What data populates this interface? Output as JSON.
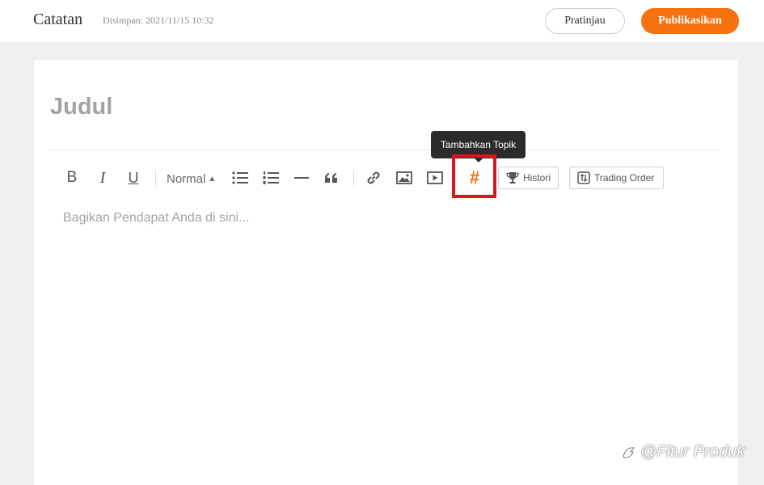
{
  "header": {
    "app_title": "Catatan",
    "save_status": "Disimpan: 2021/11/15 10:32",
    "preview_label": "Pratinjau",
    "publish_label": "Publikasikan"
  },
  "editor": {
    "title_placeholder": "Judul",
    "body_placeholder": "Bagikan Pendapat Anda di sini...",
    "toolbar": {
      "bold": "B",
      "italic": "I",
      "underline": "U",
      "format_select": "Normal",
      "topic_icon": "#",
      "topic_tooltip": "Tambahkan Topik",
      "history_label": "Histori",
      "trading_order_label": "Trading Order"
    }
  },
  "watermark": {
    "text": "@Fitur Produk"
  },
  "colors": {
    "accent": "#f7710f",
    "highlight": "#e0121c",
    "tooltip_bg": "#2b2b2b",
    "page_bg": "#efefef"
  },
  "icons": [
    "bullet-list-icon",
    "numbered-list-icon",
    "horizontal-rule-icon",
    "quote-icon",
    "link-icon",
    "image-icon",
    "video-icon",
    "hashtag-icon",
    "trophy-icon",
    "trading-order-icon",
    "brand-logo-icon"
  ]
}
